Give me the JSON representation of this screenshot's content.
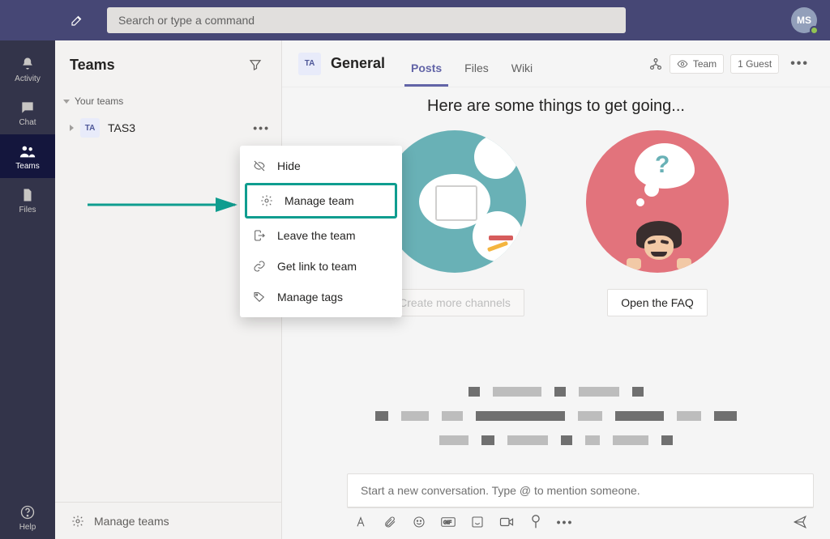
{
  "search": {
    "placeholder": "Search or type a command"
  },
  "avatar": {
    "initials": "MS"
  },
  "rail": {
    "items": [
      {
        "label": "Activity"
      },
      {
        "label": "Chat"
      },
      {
        "label": "Teams"
      },
      {
        "label": "Files"
      }
    ],
    "help": "Help"
  },
  "panel": {
    "title": "Teams",
    "group": "Your teams",
    "team": {
      "avatar": "TA",
      "name": "TAS3"
    },
    "manage": "Manage teams"
  },
  "ctx": {
    "hide": "Hide",
    "manage": "Manage team",
    "leave": "Leave the team",
    "link": "Get link to team",
    "tags": "Manage tags"
  },
  "channel": {
    "avatar": "TA",
    "name": "General",
    "tabs": {
      "posts": "Posts",
      "files": "Files",
      "wiki": "Wiki"
    },
    "visibility": "Team",
    "guests": "1 Guest"
  },
  "hero": {
    "title": "Here are some things to get going...",
    "channels_cta": "Create more channels",
    "faq_cta": "Open the FAQ"
  },
  "composer": {
    "placeholder": "Start a new conversation. Type @ to mention someone."
  },
  "colors": {
    "accent": "#6264a7",
    "highlight": "#0f9d8f"
  }
}
